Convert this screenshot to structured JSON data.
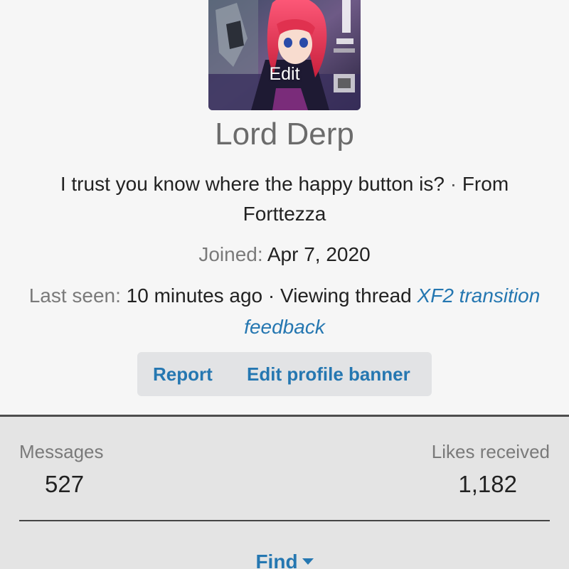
{
  "profile": {
    "avatar_edit_label": "Edit",
    "username": "Lord Derp",
    "custom_title": "I trust you know where the happy button is?",
    "separator": "·",
    "from_label": "From",
    "location": "Forttezza"
  },
  "joined": {
    "label": "Joined:",
    "value": "Apr 7, 2020"
  },
  "last_seen": {
    "label": "Last seen:",
    "value": "10 minutes ago",
    "separator": "·",
    "activity": "Viewing thread",
    "thread_title": "XF2 transition feedback"
  },
  "actions": {
    "report_label": "Report",
    "edit_banner_label": "Edit profile banner"
  },
  "stats": {
    "messages_label": "Messages",
    "messages_value": "527",
    "likes_label": "Likes received",
    "likes_value": "1,182"
  },
  "find": {
    "label": "Find",
    "icon": "caret-down-icon"
  },
  "colors": {
    "link": "#2577b1",
    "background": "#f6f6f6",
    "stats_background": "#e4e4e4"
  }
}
